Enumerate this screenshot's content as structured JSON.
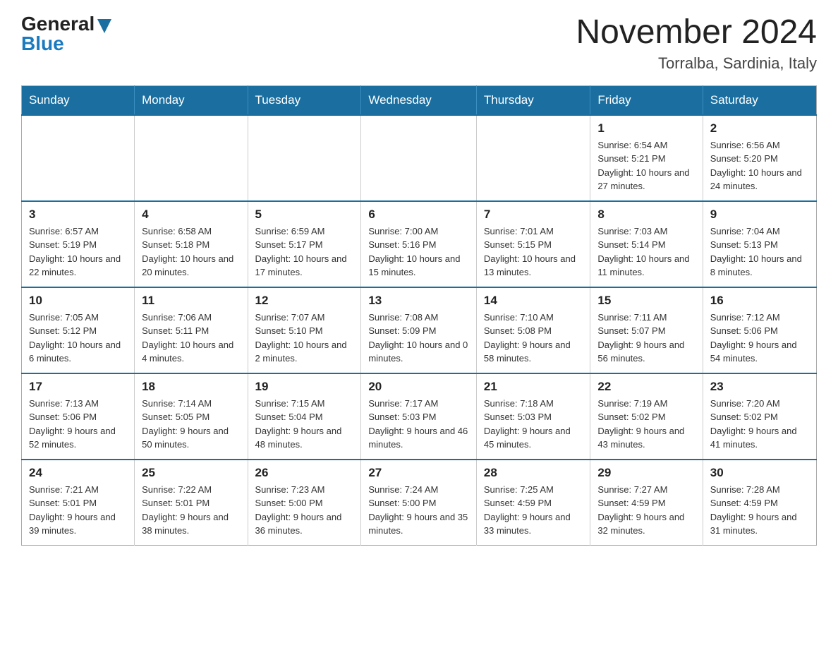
{
  "header": {
    "logo_general": "General",
    "logo_blue": "Blue",
    "month_title": "November 2024",
    "location": "Torralba, Sardinia, Italy"
  },
  "weekdays": [
    "Sunday",
    "Monday",
    "Tuesday",
    "Wednesday",
    "Thursday",
    "Friday",
    "Saturday"
  ],
  "weeks": [
    [
      {
        "day": "",
        "sunrise": "",
        "sunset": "",
        "daylight": ""
      },
      {
        "day": "",
        "sunrise": "",
        "sunset": "",
        "daylight": ""
      },
      {
        "day": "",
        "sunrise": "",
        "sunset": "",
        "daylight": ""
      },
      {
        "day": "",
        "sunrise": "",
        "sunset": "",
        "daylight": ""
      },
      {
        "day": "",
        "sunrise": "",
        "sunset": "",
        "daylight": ""
      },
      {
        "day": "1",
        "sunrise": "Sunrise: 6:54 AM",
        "sunset": "Sunset: 5:21 PM",
        "daylight": "Daylight: 10 hours and 27 minutes."
      },
      {
        "day": "2",
        "sunrise": "Sunrise: 6:56 AM",
        "sunset": "Sunset: 5:20 PM",
        "daylight": "Daylight: 10 hours and 24 minutes."
      }
    ],
    [
      {
        "day": "3",
        "sunrise": "Sunrise: 6:57 AM",
        "sunset": "Sunset: 5:19 PM",
        "daylight": "Daylight: 10 hours and 22 minutes."
      },
      {
        "day": "4",
        "sunrise": "Sunrise: 6:58 AM",
        "sunset": "Sunset: 5:18 PM",
        "daylight": "Daylight: 10 hours and 20 minutes."
      },
      {
        "day": "5",
        "sunrise": "Sunrise: 6:59 AM",
        "sunset": "Sunset: 5:17 PM",
        "daylight": "Daylight: 10 hours and 17 minutes."
      },
      {
        "day": "6",
        "sunrise": "Sunrise: 7:00 AM",
        "sunset": "Sunset: 5:16 PM",
        "daylight": "Daylight: 10 hours and 15 minutes."
      },
      {
        "day": "7",
        "sunrise": "Sunrise: 7:01 AM",
        "sunset": "Sunset: 5:15 PM",
        "daylight": "Daylight: 10 hours and 13 minutes."
      },
      {
        "day": "8",
        "sunrise": "Sunrise: 7:03 AM",
        "sunset": "Sunset: 5:14 PM",
        "daylight": "Daylight: 10 hours and 11 minutes."
      },
      {
        "day": "9",
        "sunrise": "Sunrise: 7:04 AM",
        "sunset": "Sunset: 5:13 PM",
        "daylight": "Daylight: 10 hours and 8 minutes."
      }
    ],
    [
      {
        "day": "10",
        "sunrise": "Sunrise: 7:05 AM",
        "sunset": "Sunset: 5:12 PM",
        "daylight": "Daylight: 10 hours and 6 minutes."
      },
      {
        "day": "11",
        "sunrise": "Sunrise: 7:06 AM",
        "sunset": "Sunset: 5:11 PM",
        "daylight": "Daylight: 10 hours and 4 minutes."
      },
      {
        "day": "12",
        "sunrise": "Sunrise: 7:07 AM",
        "sunset": "Sunset: 5:10 PM",
        "daylight": "Daylight: 10 hours and 2 minutes."
      },
      {
        "day": "13",
        "sunrise": "Sunrise: 7:08 AM",
        "sunset": "Sunset: 5:09 PM",
        "daylight": "Daylight: 10 hours and 0 minutes."
      },
      {
        "day": "14",
        "sunrise": "Sunrise: 7:10 AM",
        "sunset": "Sunset: 5:08 PM",
        "daylight": "Daylight: 9 hours and 58 minutes."
      },
      {
        "day": "15",
        "sunrise": "Sunrise: 7:11 AM",
        "sunset": "Sunset: 5:07 PM",
        "daylight": "Daylight: 9 hours and 56 minutes."
      },
      {
        "day": "16",
        "sunrise": "Sunrise: 7:12 AM",
        "sunset": "Sunset: 5:06 PM",
        "daylight": "Daylight: 9 hours and 54 minutes."
      }
    ],
    [
      {
        "day": "17",
        "sunrise": "Sunrise: 7:13 AM",
        "sunset": "Sunset: 5:06 PM",
        "daylight": "Daylight: 9 hours and 52 minutes."
      },
      {
        "day": "18",
        "sunrise": "Sunrise: 7:14 AM",
        "sunset": "Sunset: 5:05 PM",
        "daylight": "Daylight: 9 hours and 50 minutes."
      },
      {
        "day": "19",
        "sunrise": "Sunrise: 7:15 AM",
        "sunset": "Sunset: 5:04 PM",
        "daylight": "Daylight: 9 hours and 48 minutes."
      },
      {
        "day": "20",
        "sunrise": "Sunrise: 7:17 AM",
        "sunset": "Sunset: 5:03 PM",
        "daylight": "Daylight: 9 hours and 46 minutes."
      },
      {
        "day": "21",
        "sunrise": "Sunrise: 7:18 AM",
        "sunset": "Sunset: 5:03 PM",
        "daylight": "Daylight: 9 hours and 45 minutes."
      },
      {
        "day": "22",
        "sunrise": "Sunrise: 7:19 AM",
        "sunset": "Sunset: 5:02 PM",
        "daylight": "Daylight: 9 hours and 43 minutes."
      },
      {
        "day": "23",
        "sunrise": "Sunrise: 7:20 AM",
        "sunset": "Sunset: 5:02 PM",
        "daylight": "Daylight: 9 hours and 41 minutes."
      }
    ],
    [
      {
        "day": "24",
        "sunrise": "Sunrise: 7:21 AM",
        "sunset": "Sunset: 5:01 PM",
        "daylight": "Daylight: 9 hours and 39 minutes."
      },
      {
        "day": "25",
        "sunrise": "Sunrise: 7:22 AM",
        "sunset": "Sunset: 5:01 PM",
        "daylight": "Daylight: 9 hours and 38 minutes."
      },
      {
        "day": "26",
        "sunrise": "Sunrise: 7:23 AM",
        "sunset": "Sunset: 5:00 PM",
        "daylight": "Daylight: 9 hours and 36 minutes."
      },
      {
        "day": "27",
        "sunrise": "Sunrise: 7:24 AM",
        "sunset": "Sunset: 5:00 PM",
        "daylight": "Daylight: 9 hours and 35 minutes."
      },
      {
        "day": "28",
        "sunrise": "Sunrise: 7:25 AM",
        "sunset": "Sunset: 4:59 PM",
        "daylight": "Daylight: 9 hours and 33 minutes."
      },
      {
        "day": "29",
        "sunrise": "Sunrise: 7:27 AM",
        "sunset": "Sunset: 4:59 PM",
        "daylight": "Daylight: 9 hours and 32 minutes."
      },
      {
        "day": "30",
        "sunrise": "Sunrise: 7:28 AM",
        "sunset": "Sunset: 4:59 PM",
        "daylight": "Daylight: 9 hours and 31 minutes."
      }
    ]
  ]
}
